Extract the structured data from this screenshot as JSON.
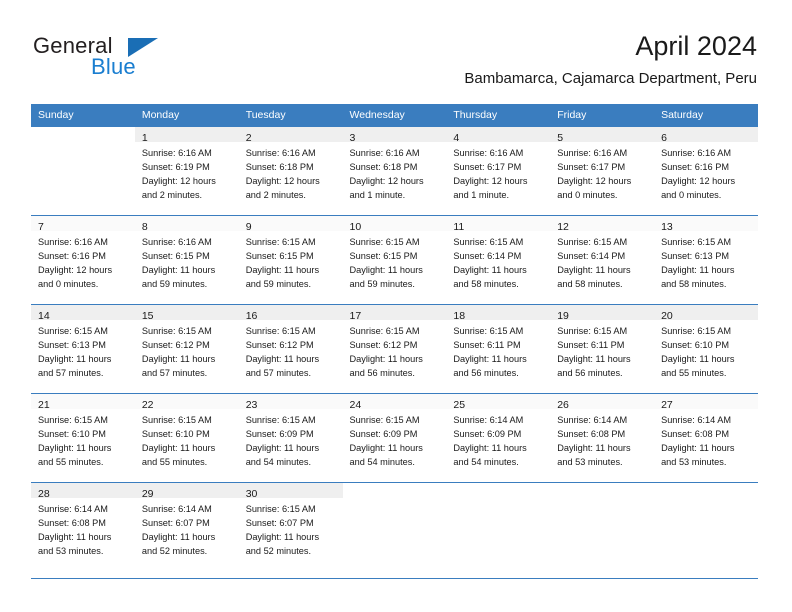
{
  "brand": {
    "name_part1": "General",
    "name_part2": "Blue",
    "accent_color": "#1a7ed0",
    "triangle_color": "#1a6eb5"
  },
  "header": {
    "title": "April 2024",
    "subtitle": "Bambamarca, Cajamarca Department, Peru"
  },
  "calendar": {
    "header_bg": "#3a7dbf",
    "header_text_color": "#ffffff",
    "weekday_headers": [
      "Sunday",
      "Monday",
      "Tuesday",
      "Wednesday",
      "Thursday",
      "Friday",
      "Saturday"
    ],
    "weeks": [
      {
        "days": [
          {
            "num": "",
            "l1": "",
            "l2": "",
            "l3": "",
            "l4": ""
          },
          {
            "num": "1",
            "l1": "Sunrise: 6:16 AM",
            "l2": "Sunset: 6:19 PM",
            "l3": "Daylight: 12 hours",
            "l4": "and 2 minutes."
          },
          {
            "num": "2",
            "l1": "Sunrise: 6:16 AM",
            "l2": "Sunset: 6:18 PM",
            "l3": "Daylight: 12 hours",
            "l4": "and 2 minutes."
          },
          {
            "num": "3",
            "l1": "Sunrise: 6:16 AM",
            "l2": "Sunset: 6:18 PM",
            "l3": "Daylight: 12 hours",
            "l4": "and 1 minute."
          },
          {
            "num": "4",
            "l1": "Sunrise: 6:16 AM",
            "l2": "Sunset: 6:17 PM",
            "l3": "Daylight: 12 hours",
            "l4": "and 1 minute."
          },
          {
            "num": "5",
            "l1": "Sunrise: 6:16 AM",
            "l2": "Sunset: 6:17 PM",
            "l3": "Daylight: 12 hours",
            "l4": "and 0 minutes."
          },
          {
            "num": "6",
            "l1": "Sunrise: 6:16 AM",
            "l2": "Sunset: 6:16 PM",
            "l3": "Daylight: 12 hours",
            "l4": "and 0 minutes."
          }
        ]
      },
      {
        "days": [
          {
            "num": "7",
            "l1": "Sunrise: 6:16 AM",
            "l2": "Sunset: 6:16 PM",
            "l3": "Daylight: 12 hours",
            "l4": "and 0 minutes."
          },
          {
            "num": "8",
            "l1": "Sunrise: 6:16 AM",
            "l2": "Sunset: 6:15 PM",
            "l3": "Daylight: 11 hours",
            "l4": "and 59 minutes."
          },
          {
            "num": "9",
            "l1": "Sunrise: 6:15 AM",
            "l2": "Sunset: 6:15 PM",
            "l3": "Daylight: 11 hours",
            "l4": "and 59 minutes."
          },
          {
            "num": "10",
            "l1": "Sunrise: 6:15 AM",
            "l2": "Sunset: 6:15 PM",
            "l3": "Daylight: 11 hours",
            "l4": "and 59 minutes."
          },
          {
            "num": "11",
            "l1": "Sunrise: 6:15 AM",
            "l2": "Sunset: 6:14 PM",
            "l3": "Daylight: 11 hours",
            "l4": "and 58 minutes."
          },
          {
            "num": "12",
            "l1": "Sunrise: 6:15 AM",
            "l2": "Sunset: 6:14 PM",
            "l3": "Daylight: 11 hours",
            "l4": "and 58 minutes."
          },
          {
            "num": "13",
            "l1": "Sunrise: 6:15 AM",
            "l2": "Sunset: 6:13 PM",
            "l3": "Daylight: 11 hours",
            "l4": "and 58 minutes."
          }
        ]
      },
      {
        "days": [
          {
            "num": "14",
            "l1": "Sunrise: 6:15 AM",
            "l2": "Sunset: 6:13 PM",
            "l3": "Daylight: 11 hours",
            "l4": "and 57 minutes."
          },
          {
            "num": "15",
            "l1": "Sunrise: 6:15 AM",
            "l2": "Sunset: 6:12 PM",
            "l3": "Daylight: 11 hours",
            "l4": "and 57 minutes."
          },
          {
            "num": "16",
            "l1": "Sunrise: 6:15 AM",
            "l2": "Sunset: 6:12 PM",
            "l3": "Daylight: 11 hours",
            "l4": "and 57 minutes."
          },
          {
            "num": "17",
            "l1": "Sunrise: 6:15 AM",
            "l2": "Sunset: 6:12 PM",
            "l3": "Daylight: 11 hours",
            "l4": "and 56 minutes."
          },
          {
            "num": "18",
            "l1": "Sunrise: 6:15 AM",
            "l2": "Sunset: 6:11 PM",
            "l3": "Daylight: 11 hours",
            "l4": "and 56 minutes."
          },
          {
            "num": "19",
            "l1": "Sunrise: 6:15 AM",
            "l2": "Sunset: 6:11 PM",
            "l3": "Daylight: 11 hours",
            "l4": "and 56 minutes."
          },
          {
            "num": "20",
            "l1": "Sunrise: 6:15 AM",
            "l2": "Sunset: 6:10 PM",
            "l3": "Daylight: 11 hours",
            "l4": "and 55 minutes."
          }
        ]
      },
      {
        "days": [
          {
            "num": "21",
            "l1": "Sunrise: 6:15 AM",
            "l2": "Sunset: 6:10 PM",
            "l3": "Daylight: 11 hours",
            "l4": "and 55 minutes."
          },
          {
            "num": "22",
            "l1": "Sunrise: 6:15 AM",
            "l2": "Sunset: 6:10 PM",
            "l3": "Daylight: 11 hours",
            "l4": "and 55 minutes."
          },
          {
            "num": "23",
            "l1": "Sunrise: 6:15 AM",
            "l2": "Sunset: 6:09 PM",
            "l3": "Daylight: 11 hours",
            "l4": "and 54 minutes."
          },
          {
            "num": "24",
            "l1": "Sunrise: 6:15 AM",
            "l2": "Sunset: 6:09 PM",
            "l3": "Daylight: 11 hours",
            "l4": "and 54 minutes."
          },
          {
            "num": "25",
            "l1": "Sunrise: 6:14 AM",
            "l2": "Sunset: 6:09 PM",
            "l3": "Daylight: 11 hours",
            "l4": "and 54 minutes."
          },
          {
            "num": "26",
            "l1": "Sunrise: 6:14 AM",
            "l2": "Sunset: 6:08 PM",
            "l3": "Daylight: 11 hours",
            "l4": "and 53 minutes."
          },
          {
            "num": "27",
            "l1": "Sunrise: 6:14 AM",
            "l2": "Sunset: 6:08 PM",
            "l3": "Daylight: 11 hours",
            "l4": "and 53 minutes."
          }
        ]
      },
      {
        "days": [
          {
            "num": "28",
            "l1": "Sunrise: 6:14 AM",
            "l2": "Sunset: 6:08 PM",
            "l3": "Daylight: 11 hours",
            "l4": "and 53 minutes."
          },
          {
            "num": "29",
            "l1": "Sunrise: 6:14 AM",
            "l2": "Sunset: 6:07 PM",
            "l3": "Daylight: 11 hours",
            "l4": "and 52 minutes."
          },
          {
            "num": "30",
            "l1": "Sunrise: 6:15 AM",
            "l2": "Sunset: 6:07 PM",
            "l3": "Daylight: 11 hours",
            "l4": "and 52 minutes."
          },
          {
            "num": "",
            "l1": "",
            "l2": "",
            "l3": "",
            "l4": ""
          },
          {
            "num": "",
            "l1": "",
            "l2": "",
            "l3": "",
            "l4": ""
          },
          {
            "num": "",
            "l1": "",
            "l2": "",
            "l3": "",
            "l4": ""
          },
          {
            "num": "",
            "l1": "",
            "l2": "",
            "l3": "",
            "l4": ""
          }
        ]
      }
    ]
  }
}
